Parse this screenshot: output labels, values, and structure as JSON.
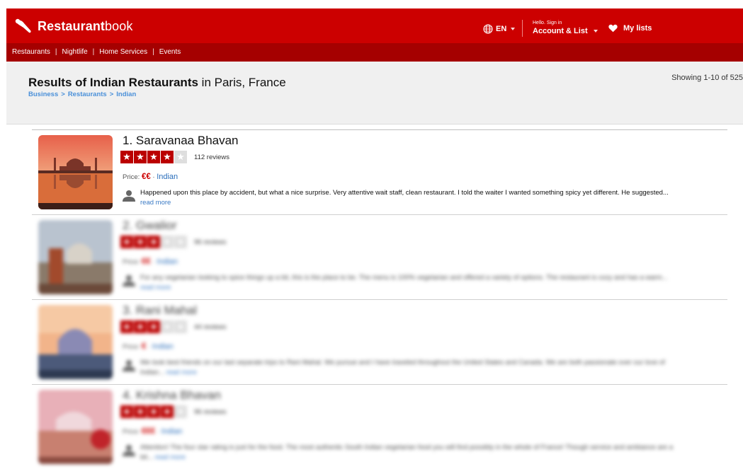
{
  "header": {
    "brand_bold": "Restaurant",
    "brand_light": "book",
    "language": "EN",
    "hello": "Hello. Sign in",
    "account": "Account & List",
    "my_lists": "My lists",
    "brand_color": "#cc0000",
    "nav_color": "#a50000"
  },
  "nav": {
    "items": [
      "Restaurants",
      "Nightlife",
      "Home Services",
      "Events"
    ],
    "separator": "|"
  },
  "results_header": {
    "title_bold": "Results of Indian Restaurants",
    "title_rest": " in Paris, France",
    "crumbs": [
      "Business",
      "Restaurants",
      "Indian"
    ],
    "crumb_sep": ">",
    "showing": "Showing 1-10 of 525"
  },
  "results": [
    {
      "title": "1. Saravanaa Bhavan",
      "stars": 4,
      "reviews": "112 reviews",
      "price_label": "Price:",
      "price": "€€",
      "cuisine": "Indian",
      "review_text": "Happened upon this place by accident, but what a nice surprise. Very attentive wait staff, clean restaurant. I told the waiter I wanted something spicy yet different. He suggested...",
      "read_more": "read more",
      "thumb": "taj-mahal-sunset-image"
    },
    {
      "title": "2. Gwalior",
      "stars": 3,
      "reviews": "96 reviews",
      "price_label": "Price:",
      "price": "€€",
      "cuisine": "Indian",
      "review_text": "For any vegetarian looking to spice things up a bit, this is the place to be. The menu is 100% vegetarian and offered a variety of options. The restaurant is cozy and has a warm...",
      "read_more": "read more",
      "thumb": "taj-mahal-dusk-image"
    },
    {
      "title": "3. Rani Mahal",
      "stars": 3,
      "reviews": "44 reviews",
      "price_label": "Price:",
      "price": "€",
      "cuisine": "Indian",
      "review_text": "We took best friends on our last separate trips to Rani Mahal. We pursue and I have traveled throughout the United States and Canada. We are both passionate over our love of Indian...",
      "read_more": "read more",
      "thumb": "taj-mahal-sunrise-image"
    },
    {
      "title": "4. Krishna Bhavan",
      "stars": 4,
      "reviews": "96 reviews",
      "price_label": "Price:",
      "price": "€€€",
      "cuisine": "Indian",
      "review_text": "Attention! The four star rating is just for the food. The most authentic South Indian vegetarian food you will find possibly in the whole of France! Though service and ambiance are a bit...",
      "read_more": "read more",
      "thumb": "taj-mahal-pink-image"
    }
  ]
}
